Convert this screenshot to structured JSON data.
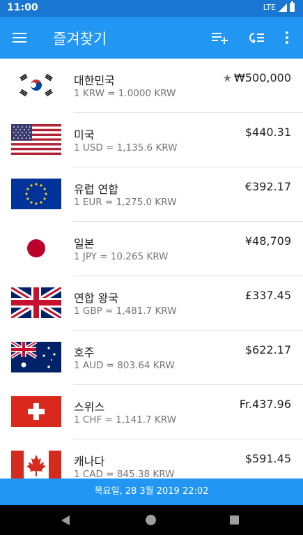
{
  "status": {
    "time": "11:00",
    "network": "LTE"
  },
  "app_bar": {
    "title": "즐겨찾기"
  },
  "currencies": [
    {
      "country": "대한민국",
      "rate": "1 KRW = 1.0000 KRW",
      "amount": "₩500,000",
      "base": true,
      "flag": "kr-flag-icon"
    },
    {
      "country": "미국",
      "rate": "1 USD = 1,135.6 KRW",
      "amount": "$440.31",
      "flag": "us-flag-icon"
    },
    {
      "country": "유럽 연합",
      "rate": "1 EUR = 1,275.0 KRW",
      "amount": "€392.17",
      "flag": "eu-flag-icon"
    },
    {
      "country": "일본",
      "rate": "1 JPY = 10.265 KRW",
      "amount": "¥48,709",
      "flag": "jp-flag-icon"
    },
    {
      "country": "연합 왕국",
      "rate": "1 GBP = 1,481.7 KRW",
      "amount": "£337.45",
      "flag": "gb-flag-icon"
    },
    {
      "country": "호주",
      "rate": "1 AUD = 803.64 KRW",
      "amount": "$622.17",
      "flag": "au-flag-icon"
    },
    {
      "country": "스위스",
      "rate": "1 CHF = 1,141.7 KRW",
      "amount": "Fr.437.96",
      "flag": "ch-flag-icon"
    },
    {
      "country": "캐나다",
      "rate": "1 CAD = 845.38 KRW",
      "amount": "$591.45",
      "flag": "ca-flag-icon"
    }
  ],
  "footer": {
    "updated": "목요일, 28 3월 2019 22:02"
  },
  "colors": {
    "primary": "#2196f3",
    "primary_dark": "#1976d2"
  }
}
